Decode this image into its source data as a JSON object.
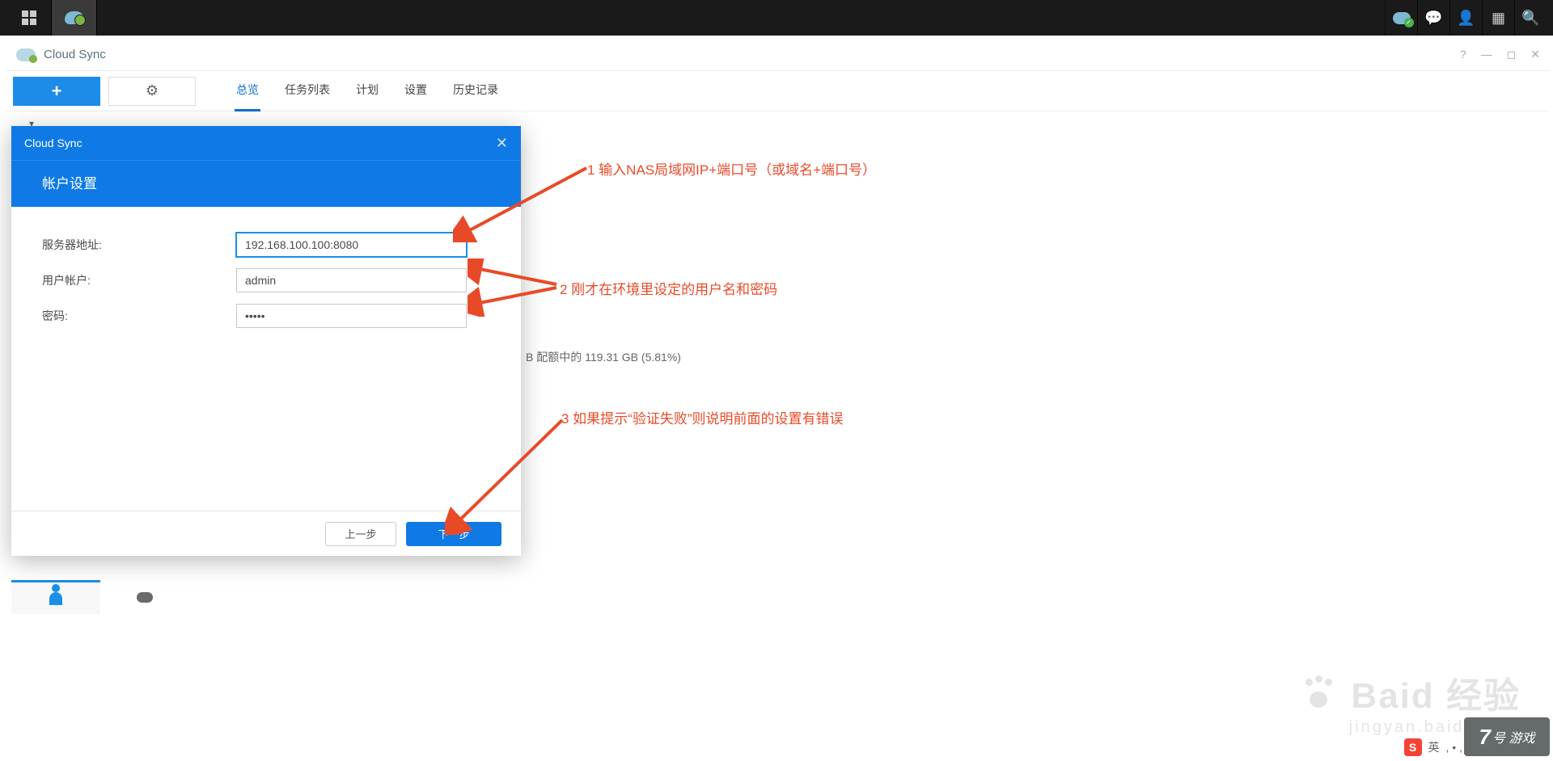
{
  "taskbar": {},
  "app": {
    "title": "Cloud Sync",
    "titlebar_help": "?",
    "titlebar_min": "—",
    "titlebar_max": "◻",
    "titlebar_close": "✕"
  },
  "toolbar": {
    "add": "+",
    "settings": "✿"
  },
  "tabs": {
    "items": [
      "总览",
      "任务列表",
      "计划",
      "设置",
      "历史记录"
    ],
    "active_index": 0
  },
  "modal": {
    "title": "Cloud Sync",
    "subtitle": "帐户设置",
    "fields": {
      "server_label": "服务器地址:",
      "server_value": "192.168.100.100:8080",
      "user_label": "用户帐户:",
      "user_value": "admin",
      "password_label": "密码:",
      "password_value": "•••••"
    },
    "buttons": {
      "prev": "上一步",
      "next": "下一步"
    }
  },
  "annotations": {
    "a1": "1 输入NAS局域网IP+端口号（或域名+端口号）",
    "a2": "2 刚才在环境里设定的用户名和密码",
    "a3": "3 如果提示“验证失败”则说明前面的设置有错误"
  },
  "bg": {
    "quota_text": "B 配额中的 119.31 GB (5.81%)"
  },
  "watermark": {
    "line1": "Baid 经验",
    "line2": "jingyan.baidu.com"
  },
  "ime": {
    "s_label": "S",
    "lang": "英",
    "dots": ", • ,"
  },
  "corner": {
    "num": "7",
    "text": "号 游戏"
  }
}
